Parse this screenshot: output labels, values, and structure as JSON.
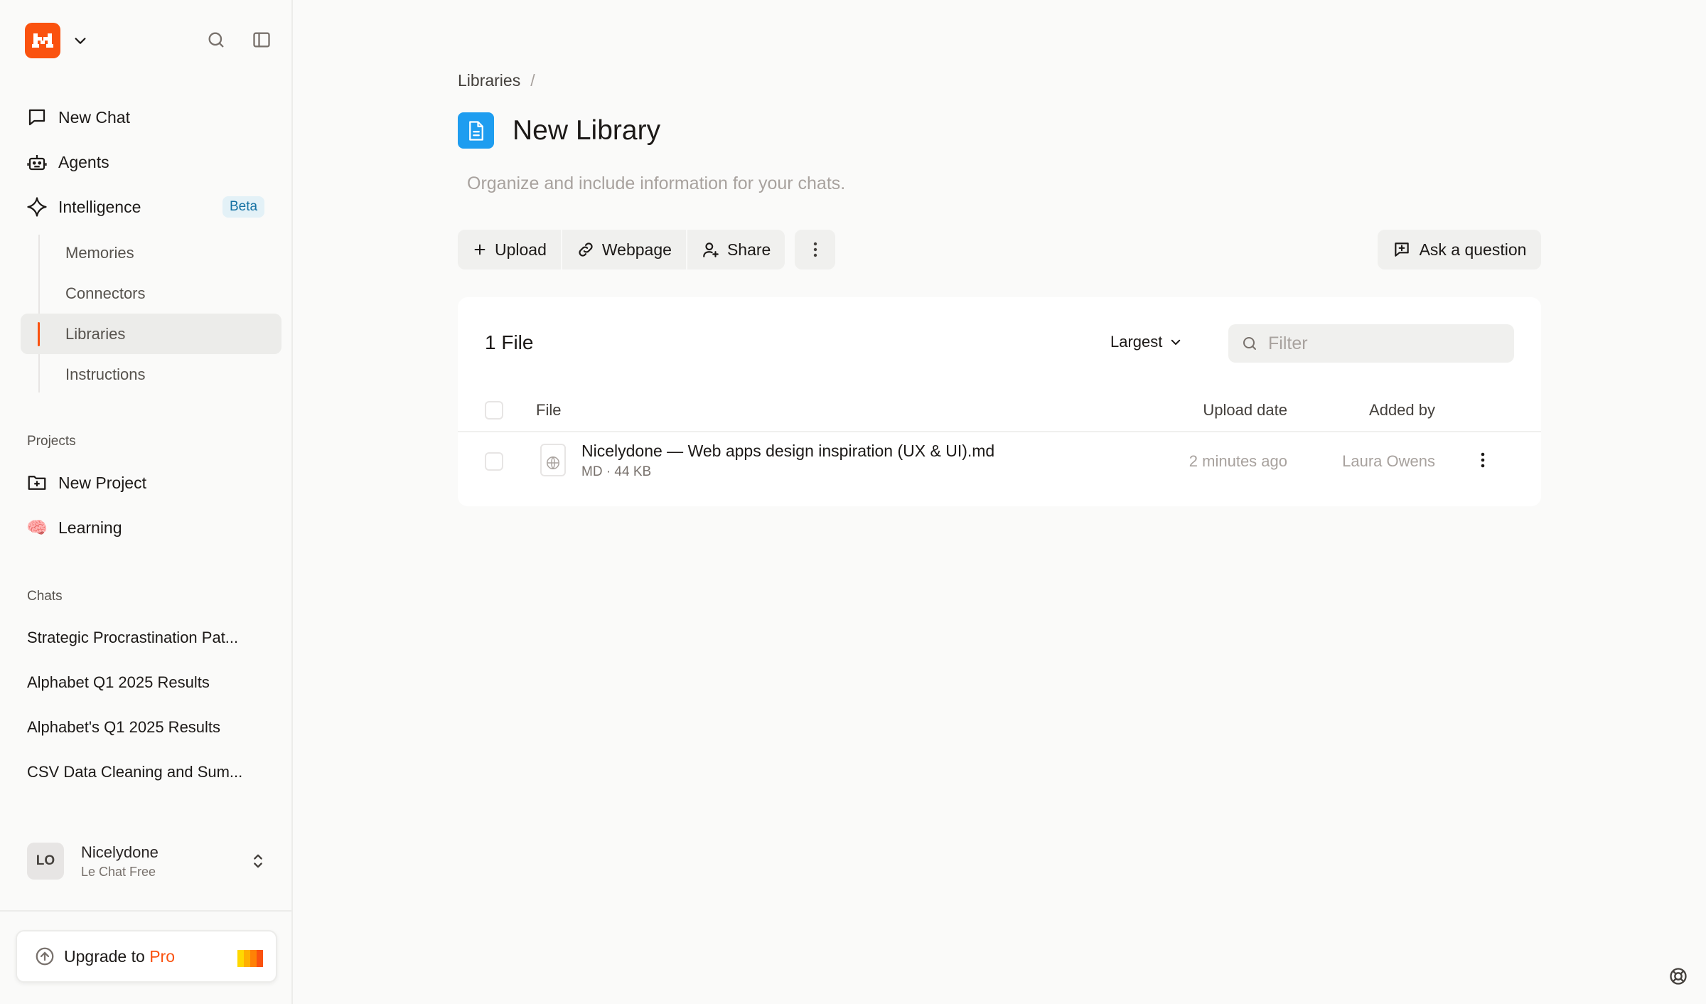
{
  "sidebar": {
    "nav": {
      "new_chat": "New Chat",
      "agents": "Agents",
      "intelligence": "Intelligence",
      "beta_badge": "Beta"
    },
    "intelligence_items": [
      "Memories",
      "Connectors",
      "Libraries",
      "Instructions"
    ],
    "projects_label": "Projects",
    "projects": {
      "new_project": "New Project",
      "learning": "Learning",
      "learning_emoji": "🧠"
    },
    "chats_label": "Chats",
    "chats": [
      "Strategic Procrastination Pat...",
      "Alphabet Q1 2025 Results",
      "Alphabet's Q1 2025 Results",
      "CSV Data Cleaning and Sum..."
    ],
    "user": {
      "initials": "LO",
      "name": "Nicelydone",
      "plan": "Le Chat Free"
    },
    "upgrade": {
      "prefix": "Upgrade to",
      "highlight": "Pro"
    }
  },
  "main": {
    "breadcrumb": {
      "root": "Libraries",
      "separator": "/"
    },
    "title": "New Library",
    "description": "Organize and include information for your chats.",
    "toolbar": {
      "upload": "Upload",
      "webpage": "Webpage",
      "share": "Share",
      "ask": "Ask a question"
    },
    "files": {
      "count_label": "1 File",
      "sort_label": "Largest",
      "filter_placeholder": "Filter",
      "columns": {
        "file": "File",
        "upload_date": "Upload date",
        "added_by": "Added by"
      },
      "rows": [
        {
          "name": "Nicelydone — Web apps design inspiration (UX & UI).md",
          "meta": "MD · 44 KB",
          "date": "2 minutes ago",
          "added_by": "Laura Owens"
        }
      ]
    }
  },
  "colors": {
    "brand": "#fa520f",
    "library_icon": "#1e9df0",
    "beta_bg": "#e3f1f7",
    "beta_text": "#1672a3"
  },
  "icons": {
    "logo": "mistral-logo-icon",
    "search": "search-icon",
    "sidebar_toggle": "sidebar-toggle-icon",
    "help": "lifebuoy-icon"
  }
}
